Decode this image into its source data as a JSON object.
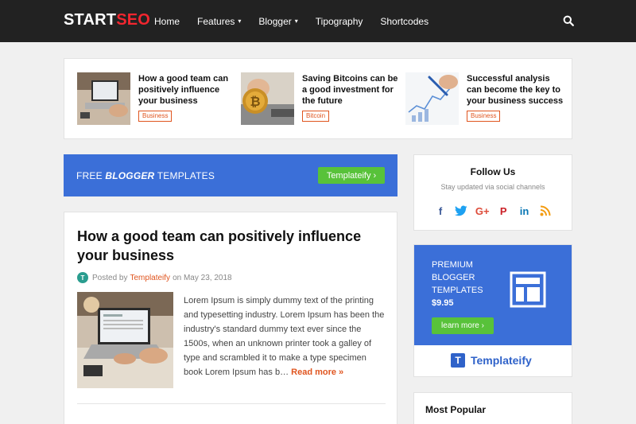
{
  "header": {
    "logo_start": "START",
    "logo_seo": "SEO",
    "nav": [
      {
        "label": "Home"
      },
      {
        "label": "Features",
        "dropdown": true
      },
      {
        "label": "Blogger",
        "dropdown": true
      },
      {
        "label": "Tipography"
      },
      {
        "label": "Shortcodes"
      }
    ],
    "caret": "▾"
  },
  "featured": [
    {
      "title": "How a good team can positively influence your business",
      "tag": "Business"
    },
    {
      "title": "Saving Bitcoins can be a good investment for the future",
      "tag": "Bitcoin"
    },
    {
      "title": "Successful analysis can become the key to your business success",
      "tag": "Business"
    }
  ],
  "banner": {
    "free": "FREE",
    "blogger": "BLOGGER",
    "templates": "TEMPLATES",
    "button": "Templateify ›"
  },
  "post": {
    "title": "How a good team can positively influence your business",
    "posted_by": "Posted by",
    "author": "Templateify",
    "on": "on",
    "date": "May 23, 2018",
    "excerpt": "Lorem Ipsum is simply dummy text of the printing and typesetting industry. Lorem Ipsum has been the industry's standard dummy text ever since the 1500s, when an unknown printer took a galley of type and scrambled it to make a type specimen book Lorem Ipsum has b…",
    "read_more": "Read more »"
  },
  "follow": {
    "title": "Follow Us",
    "subtitle": "Stay updated via social channels",
    "icons": [
      {
        "name": "facebook-icon",
        "glyph": "f",
        "color": "#3b5998"
      },
      {
        "name": "twitter-icon",
        "glyph": "t",
        "color": "#1da1f2"
      },
      {
        "name": "google-plus-icon",
        "glyph": "G+",
        "color": "#dd4b39"
      },
      {
        "name": "pinterest-icon",
        "glyph": "P",
        "color": "#cb2027"
      },
      {
        "name": "linkedin-icon",
        "glyph": "in",
        "color": "#0976b4"
      },
      {
        "name": "rss-icon",
        "glyph": "◉",
        "color": "#f39c12"
      }
    ]
  },
  "promo": {
    "line1": "PREMIUM",
    "line2": "BLOGGER",
    "line3": "TEMPLATES",
    "price": "$9.95",
    "button": "learn more ›",
    "brand": "Templateify",
    "brand_mark": "T"
  },
  "popular": {
    "title": "Most Popular"
  },
  "colors": {
    "accent": "#e0551f",
    "primary": "#3b6fd8",
    "green": "#58c23a",
    "header": "#222222"
  }
}
